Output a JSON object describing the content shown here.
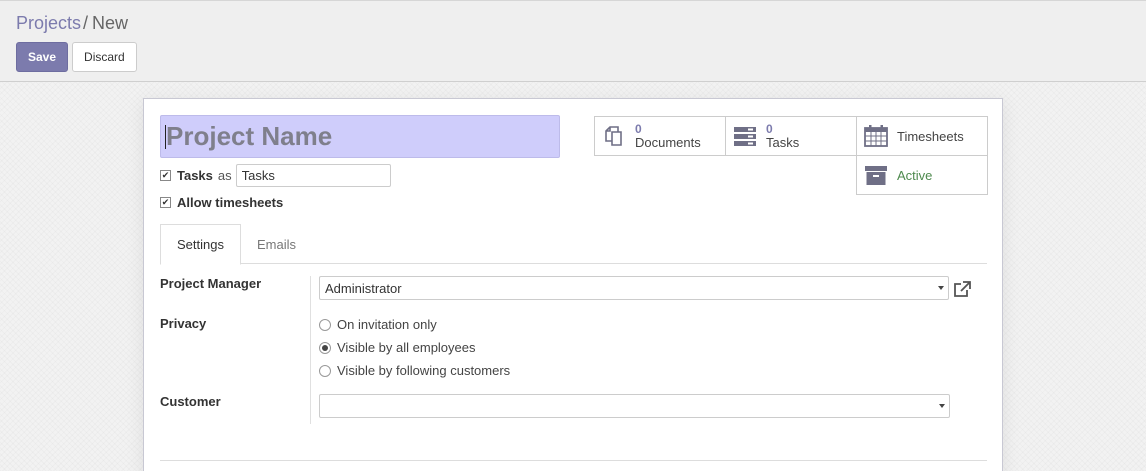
{
  "breadcrumb": {
    "parent": "Projects",
    "separator": "/",
    "current": "New"
  },
  "toolbar": {
    "save_label": "Save",
    "discard_label": "Discard"
  },
  "form": {
    "name_placeholder": "Project Name",
    "tasks_label": "Tasks",
    "tasks_as": "as",
    "tasks_alias_value": "Tasks",
    "allow_timesheets_label": "Allow timesheets"
  },
  "smart_buttons": {
    "documents": {
      "count": "0",
      "label": "Documents",
      "icon": "documents-icon"
    },
    "tasks": {
      "count": "0",
      "label": "Tasks",
      "icon": "tasks-icon"
    },
    "timesheets": {
      "label": "Timesheets",
      "icon": "calendar-icon"
    },
    "active": {
      "label": "Active",
      "icon": "archive-icon"
    }
  },
  "tabs": [
    {
      "label": "Settings",
      "active": true
    },
    {
      "label": "Emails",
      "active": false
    }
  ],
  "settings": {
    "project_manager_label": "Project Manager",
    "project_manager_value": "Administrator",
    "privacy_label": "Privacy",
    "privacy_options": [
      {
        "label": "On invitation only",
        "selected": false
      },
      {
        "label": "Visible by all employees",
        "selected": true
      },
      {
        "label": "Visible by following customers",
        "selected": false
      }
    ],
    "customer_label": "Customer",
    "customer_value": ""
  },
  "colors": {
    "accent": "#7c7bad",
    "name_field_bg": "#cfcdfb",
    "active_text": "#4e8a4e"
  }
}
